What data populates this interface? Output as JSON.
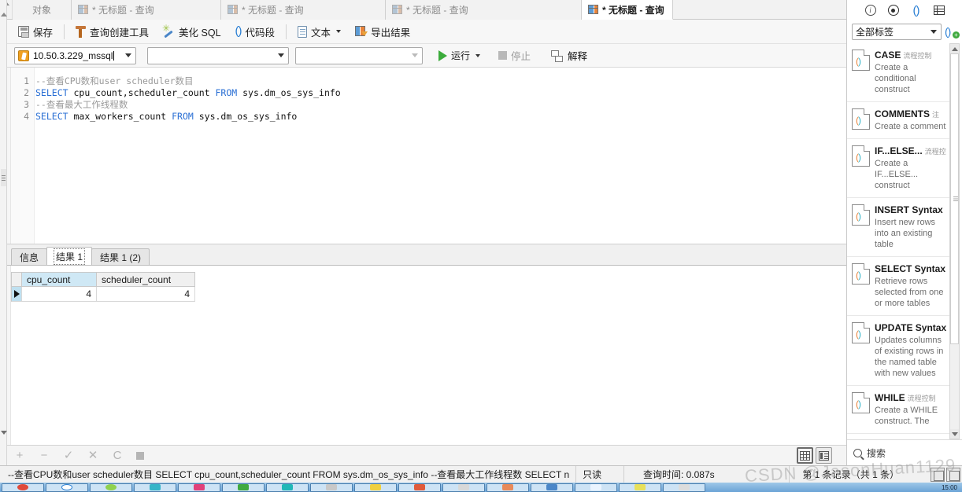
{
  "tabbar": {
    "object_tab": "对象",
    "tabs": [
      {
        "label": "* 无标题 - 查询",
        "active": false
      },
      {
        "label": "* 无标题 - 查询",
        "active": false
      },
      {
        "label": "* 无标题 - 查询",
        "active": false
      },
      {
        "label": "* 无标题 - 查询",
        "active": true
      }
    ]
  },
  "toolbar": {
    "save": "保存",
    "query_builder": "查询创建工具",
    "beautify_sql": "美化 SQL",
    "code_snippet": "代码段",
    "text": "文本",
    "export_result": "导出结果"
  },
  "connbar": {
    "connection": "10.50.3.229_mssql",
    "database": "",
    "schema": "",
    "run": "运行",
    "stop": "停止",
    "explain": "解释"
  },
  "editor": {
    "line_numbers": [
      "1",
      "2",
      "3",
      "4"
    ],
    "lines": [
      {
        "comment": "--查看CPU数和user scheduler数目"
      },
      {
        "kw1": "SELECT",
        "mid": " cpu_count,scheduler_count ",
        "kw2": "FROM",
        "tail": " sys.dm_os_sys_info"
      },
      {
        "comment": "--查看最大工作线程数"
      },
      {
        "kw1": "SELECT",
        "mid": " max_workers_count ",
        "kw2": "FROM",
        "tail": " sys.dm_os_sys_info"
      }
    ]
  },
  "result_tabs": [
    {
      "label": "信息",
      "active": false
    },
    {
      "label": "结果 1",
      "active": true
    },
    {
      "label": "结果 1 (2)",
      "active": false
    }
  ],
  "grid": {
    "columns": [
      {
        "name": "cpu_count",
        "selected": true
      },
      {
        "name": "scheduler_count",
        "selected": false
      }
    ],
    "rows": [
      {
        "cpu_count": "4",
        "scheduler_count": "4"
      }
    ]
  },
  "navbuttons": {
    "add": "+",
    "remove": "−",
    "confirm": "✓",
    "cancel": "✕",
    "refresh": "C",
    "stop": ""
  },
  "view_toggles": [
    {
      "name": "grid-view",
      "active": true
    },
    {
      "name": "form-view",
      "active": false
    }
  ],
  "statusbar": {
    "sql": "--查看CPU数和user scheduler数目  SELECT cpu_count,scheduler_count FROM sys.dm_os_sys_info  --查看最大工作线程数  SELECT n",
    "readonly": "只读",
    "query_time": "查询时间: 0.087s",
    "record_info": "第 1 条记录（共 1 条）"
  },
  "sidebar": {
    "icon_row": [
      "info-icon",
      "target-icon",
      "code-snippet-icon",
      "table-icon"
    ],
    "filter_value": "全部标签",
    "add_snippet": "add-snippet-icon",
    "snippets": [
      {
        "title": "CASE",
        "category": "流程控制",
        "desc": "Create a conditional construct"
      },
      {
        "title": "COMMENTS",
        "category": "注",
        "desc": "Create a comment"
      },
      {
        "title": "IF...ELSE...",
        "category": "流程控",
        "desc": "Create a IF...ELSE... construct"
      },
      {
        "title": "INSERT Syntax",
        "category": "",
        "desc": "Insert new rows into an existing table"
      },
      {
        "title": "SELECT Syntax",
        "category": "",
        "desc": "Retrieve rows selected from one or more tables"
      },
      {
        "title": "UPDATE Syntax",
        "category": "",
        "desc": "Updates columns of existing rows in the named table with new values"
      },
      {
        "title": "WHILE",
        "category": "流程控制",
        "desc": "Create a WHILE construct. The"
      }
    ],
    "search_placeholder": "搜索"
  },
  "watermark": "CSDN @JasonHuan1129",
  "taskbar": {
    "clock": "15:00"
  }
}
